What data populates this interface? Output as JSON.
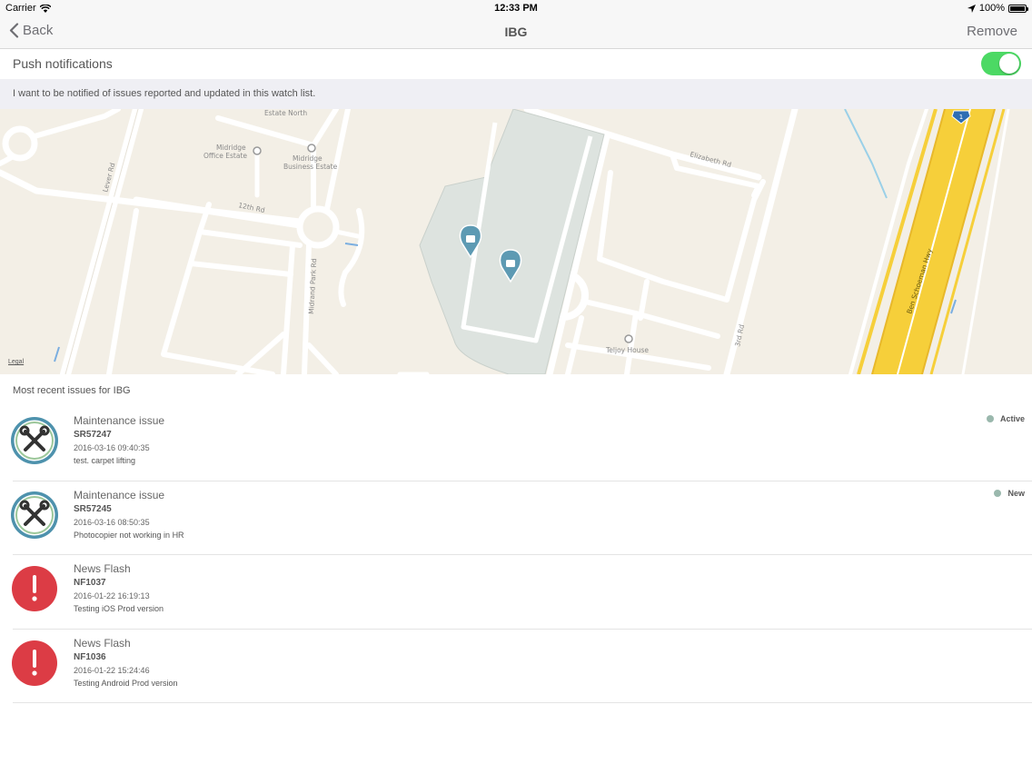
{
  "status_bar": {
    "carrier": "Carrier",
    "time": "12:33 PM",
    "battery": "100%"
  },
  "nav": {
    "back_label": "Back",
    "title": "IBG",
    "remove_label": "Remove"
  },
  "push": {
    "label": "Push notifications",
    "enabled": true,
    "description": "I want to be notified of issues reported and updated in this watch list."
  },
  "map": {
    "labels": {
      "estate_north": "Estate North",
      "midridge_office_1": "Midridge",
      "midridge_office_2": "Office Estate",
      "midridge_business_1": "Midridge",
      "midridge_business_2": "Business Estate",
      "lever_rd": "Lever Rd",
      "twelfth_rd": "12th Rd",
      "midrand_park_rd": "Midrand Park Rd",
      "elizabeth_rd": "Elizabeth Rd",
      "teljoy_house": "Teljoy House",
      "third_rd": "3rd Rd",
      "ben_schoeman_hwy": "Ben Schoeman Hwy",
      "highway_shield": "1"
    },
    "legal_label": "Legal",
    "colors": {
      "land": "#f3efe6",
      "road": "#ffffff",
      "highway": "#f6cf3a",
      "site": "#dde3df",
      "pin": "#5d9ab3"
    }
  },
  "list": {
    "header": "Most recent issues for IBG",
    "items": [
      {
        "kind": "maintenance",
        "icon": "wrench-screwdriver-icon",
        "type": "Maintenance issue",
        "id": "SR57247",
        "date": "2016-03-16 09:40:35",
        "description": "test.  carpet lifting",
        "status": "Active"
      },
      {
        "kind": "maintenance",
        "icon": "wrench-screwdriver-icon",
        "type": "Maintenance issue",
        "id": "SR57245",
        "date": "2016-03-16 08:50:35",
        "description": "Photocopier not working in HR",
        "status": "New"
      },
      {
        "kind": "news",
        "icon": "exclamation-icon",
        "type": "News Flash",
        "id": "NF1037",
        "date": "2016-01-22 16:19:13",
        "description": "Testing iOS Prod version",
        "status": ""
      },
      {
        "kind": "news",
        "icon": "exclamation-icon",
        "type": "News Flash",
        "id": "NF1036",
        "date": "2016-01-22 15:24:46",
        "description": "Testing Android Prod version",
        "status": ""
      }
    ]
  }
}
